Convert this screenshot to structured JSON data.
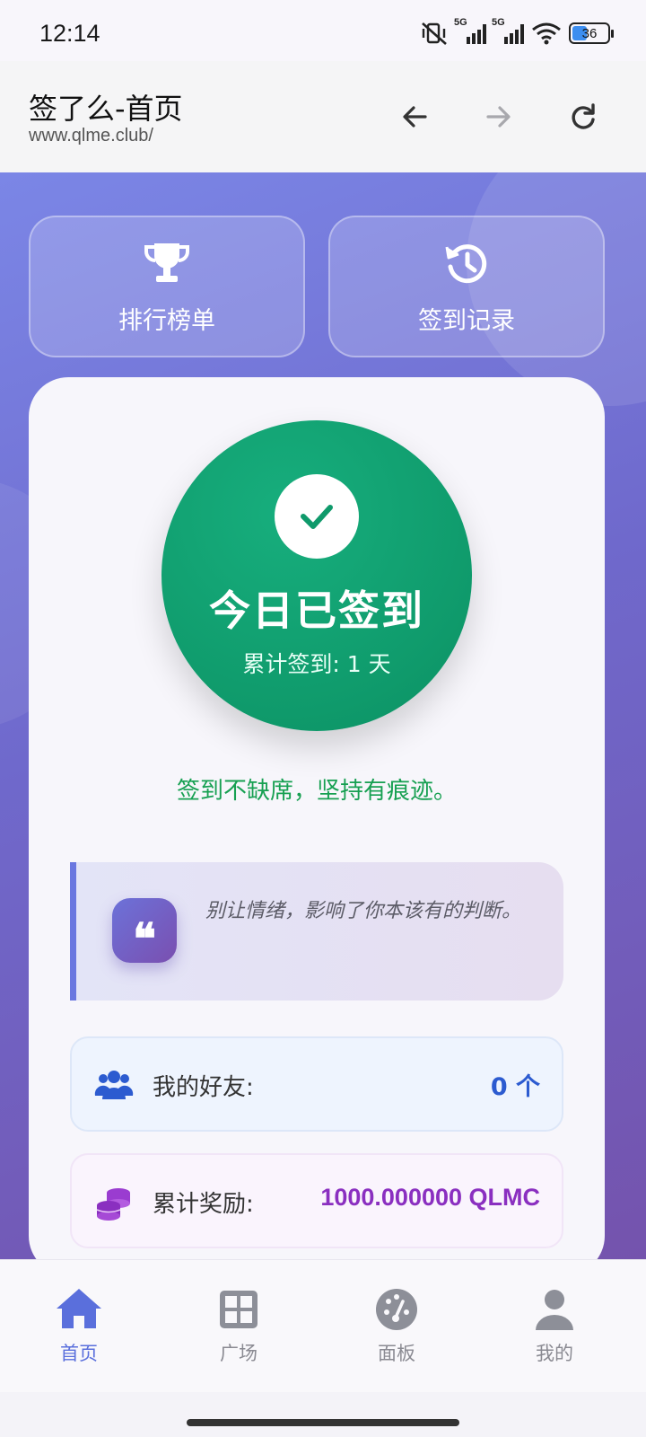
{
  "status_bar": {
    "time": "12:14",
    "signal1_label": "5G",
    "signal2_label": "5G",
    "battery": "36"
  },
  "browser": {
    "title": "签了么-首页",
    "url": "www.qlme.club/"
  },
  "quick_actions": [
    {
      "label": "排行榜单",
      "icon": "trophy-icon"
    },
    {
      "label": "签到记录",
      "icon": "history-icon"
    }
  ],
  "checkin": {
    "title": "今日已签到",
    "count_text": "累计签到: 1 天",
    "motto": "签到不缺席，坚持有痕迹。"
  },
  "quote": {
    "mark": "❝",
    "text": "别让情绪，影响了你本该有的判断。"
  },
  "stats": {
    "friends_label": "我的好友:",
    "friends_value": "0 个",
    "rewards_label": "累计奖励:",
    "rewards_value": "1000.000000 QLMC"
  },
  "bottom_nav": [
    {
      "label": "首页",
      "icon": "home-icon",
      "active": true
    },
    {
      "label": "广场",
      "icon": "grid-icon",
      "active": false
    },
    {
      "label": "面板",
      "icon": "dashboard-icon",
      "active": false
    },
    {
      "label": "我的",
      "icon": "user-icon",
      "active": false
    }
  ],
  "colors": {
    "accent": "#5a6fdc",
    "success": "#0f9a6b",
    "reward": "#8a2fc0"
  }
}
